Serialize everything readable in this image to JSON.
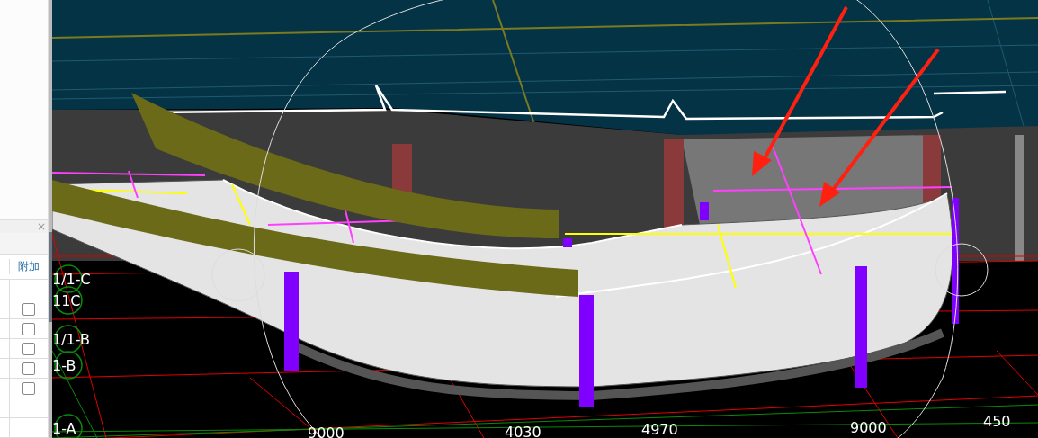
{
  "side_panel": {
    "close": "×",
    "column": "附加",
    "rows": [
      {
        "kind": "blank"
      },
      {
        "kind": "checkbox",
        "checked": false
      },
      {
        "kind": "checkbox",
        "checked": false
      },
      {
        "kind": "checkbox",
        "checked": false
      },
      {
        "kind": "checkbox",
        "checked": false
      },
      {
        "kind": "checkbox",
        "checked": false
      },
      {
        "kind": "blank"
      },
      {
        "kind": "blank"
      }
    ]
  },
  "viewport": {
    "axis_labels": [
      "1/1-C",
      "11C",
      "1/1-B",
      "1-B",
      "1-A"
    ],
    "dimension_labels": [
      "9000",
      "4030",
      "4970",
      "9000",
      "450"
    ]
  }
}
